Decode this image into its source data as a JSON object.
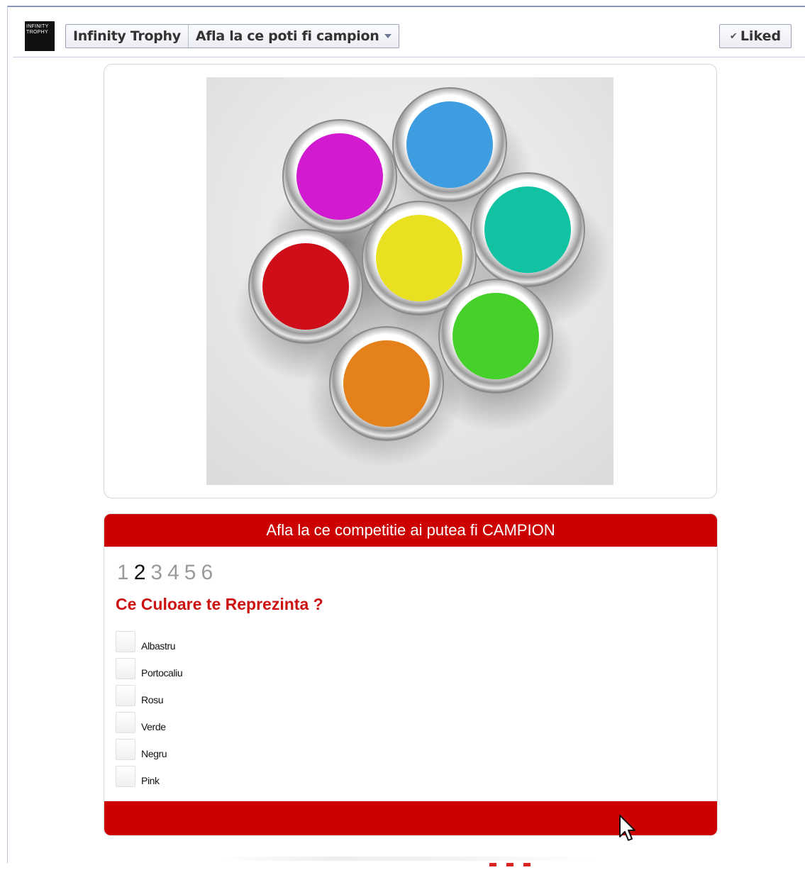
{
  "header": {
    "logo_lines": [
      "INFINITY",
      "TROPHY"
    ],
    "page_name": "Infinity Trophy",
    "tab_name": "Afla la ce poti fi campion",
    "liked_label": "Liked"
  },
  "quiz": {
    "title": "Afla la ce competitie ai putea fi CAMPION",
    "steps": [
      "1",
      "2",
      "3",
      "4",
      "5",
      "6"
    ],
    "current_step": "2",
    "question": "Ce Culoare te Reprezinta ?",
    "options": [
      "Albastru",
      "Portocaliu",
      "Rosu",
      "Verde",
      "Negru",
      "Pink"
    ]
  },
  "colors": {
    "accent_red": "#cc0000",
    "paint_magenta": "#d21bd0",
    "paint_blue": "#3d9de0",
    "paint_teal": "#12c3a3",
    "paint_yellow": "#e9e022",
    "paint_red": "#cf0e19",
    "paint_green": "#46d12a",
    "paint_orange": "#e4811a"
  },
  "icons": {
    "liked_check": "checkmark-icon",
    "dropdown": "chevron-down-icon",
    "cursor": "mouse-pointer-icon"
  }
}
